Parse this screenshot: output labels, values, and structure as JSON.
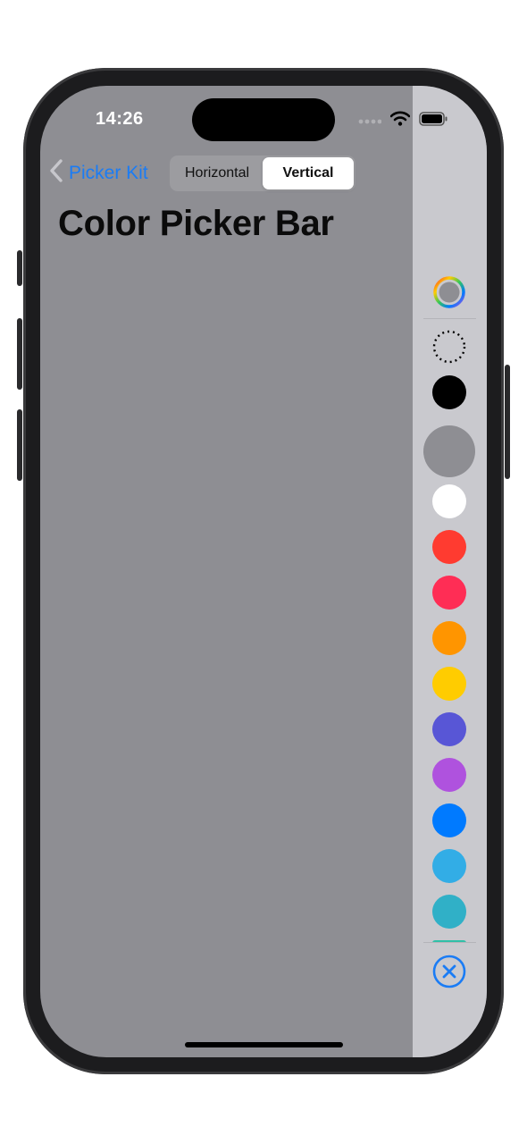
{
  "status_bar": {
    "time": "14:26",
    "icons": [
      "signal-dots-icon",
      "wifi-icon",
      "battery-icon"
    ]
  },
  "nav": {
    "back_label": "Picker Kit",
    "back_icon": "chevron-left-icon"
  },
  "segmented_control": {
    "options": [
      "Horizontal",
      "Vertical"
    ],
    "selected": "Vertical"
  },
  "page": {
    "title": "Color Picker Bar",
    "background_color": "#8e8e93"
  },
  "color_picker_bar": {
    "wheel_button_icon": "color-wheel-icon",
    "no_color_icon": "dashed-circle-icon",
    "swatches": [
      {
        "name": "black",
        "color": "#000000"
      },
      {
        "name": "gray",
        "color": "#8e8e93",
        "selected": true
      },
      {
        "name": "white",
        "color": "#ffffff"
      },
      {
        "name": "red",
        "color": "#ff3b30"
      },
      {
        "name": "pink",
        "color": "#ff2d55"
      },
      {
        "name": "orange",
        "color": "#ff9500"
      },
      {
        "name": "yellow",
        "color": "#ffcc00"
      },
      {
        "name": "indigo",
        "color": "#5856d6"
      },
      {
        "name": "purple",
        "color": "#af52de"
      },
      {
        "name": "blue",
        "color": "#007aff"
      },
      {
        "name": "cyan",
        "color": "#32ade6"
      },
      {
        "name": "teal",
        "color": "#30b0c7"
      }
    ],
    "clear_button_icon": "close-circle-icon",
    "accent_color": "#1a7cf5"
  }
}
